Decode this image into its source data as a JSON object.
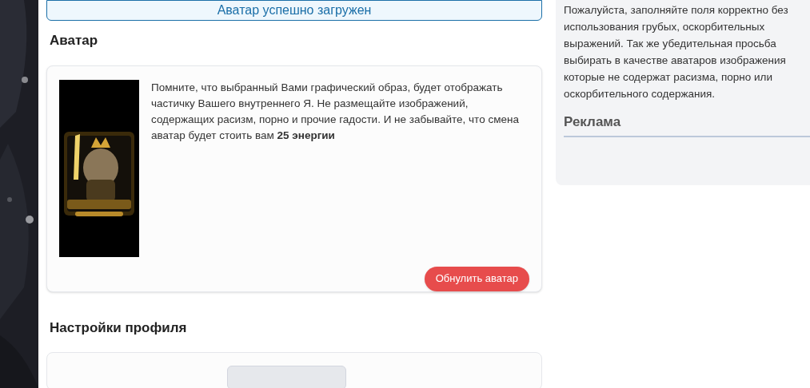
{
  "alert": {
    "text": "Аватар успешно загружен"
  },
  "avatar_section": {
    "title": "Аватар",
    "notice": "Помните, что выбранный Вами графический образ, будет отображать частичку Вашего внутреннего Я. Не размещайте изображений, содержащих расизм, порно и прочие гадости. И не забывайте, что смена аватар будет стоить вам **25 энергии**",
    "reset_button": "Обнулить аватар"
  },
  "profile_section": {
    "title": "Настройки профиля"
  },
  "sidebar": {
    "rules": "Пожалуйста, заполняйте поля корректно без использования грубых, оскорбительных выражений. Так же убедительная просьба выбирать в качестве аватаров изображения которые не содержат расизма, порно или оскорбительного содержания.",
    "ads_title": "Реклама"
  }
}
